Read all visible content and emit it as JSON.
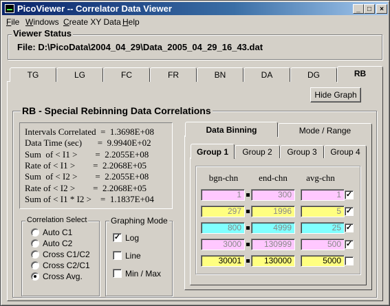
{
  "window": {
    "title": "PicoViewer -- Correlator Data Viewer",
    "min": "_",
    "max": "□",
    "close": "×"
  },
  "menu": [
    {
      "u": "F",
      "rest": "ile"
    },
    {
      "u": "W",
      "rest": "indows"
    },
    {
      "pre": "",
      "u": "C",
      "rest": "reate XY Data"
    },
    {
      "u": "H",
      "rest": "elp"
    }
  ],
  "viewer_status": {
    "title": "Viewer  Status",
    "file_line": "File: D:\\PicoData\\2004_04_29\\Data_2005_04_29_16_43.dat"
  },
  "tabs": [
    "TG",
    "LG",
    "FC",
    "FR",
    "BN",
    "DA",
    "DG",
    "RB"
  ],
  "hide_graph": "Hide Graph",
  "rb": {
    "title": "RB - Special Rebinning Data Correlations",
    "stats": [
      "Intervals Correlated  =  1.3698E+08",
      "Data Time (sec)       =  9.9940E+02",
      "Sum  of < I1 >        =  2.2055E+08",
      "Rate of < I1 >        =  2.2068E+05",
      "Sum  of < I2 >        =  2.2055E+08",
      "Rate of < I2 >        =  2.2068E+05",
      "Sum of < I1 * I2 >    =  1.1837E+04"
    ]
  },
  "correlation_select": {
    "title": "Correlation Select",
    "options": [
      "Auto  C1",
      "Auto  C2",
      "Cross C1/C2",
      "Cross C2/C1",
      "Cross Avg."
    ],
    "selected": 4
  },
  "graphing_mode": {
    "title": "Graphing  Mode",
    "options": [
      {
        "label": "Log",
        "checked": true
      },
      {
        "label": "Line",
        "checked": false
      },
      {
        "label": "Min / Max",
        "checked": false
      }
    ]
  },
  "binning_tabs": [
    "Data Binning",
    "Mode / Range"
  ],
  "group_tabs": [
    "Group 1",
    "Group 2",
    "Group 3",
    "Group 4"
  ],
  "columns": [
    "bgn-chn",
    "end-chn",
    "avg-chn"
  ],
  "rows": [
    {
      "bgn": "1",
      "end": "300",
      "avg": "1",
      "color": "#ffc8ff",
      "dim": true,
      "checked": true
    },
    {
      "bgn": "297",
      "end": "1996",
      "avg": "5",
      "color": "#ffff80",
      "dim": true,
      "checked": true
    },
    {
      "bgn": "800",
      "end": "4999",
      "avg": "25",
      "color": "#80ffff",
      "dim": true,
      "checked": true
    },
    {
      "bgn": "3000",
      "end": "130999",
      "avg": "500",
      "color": "#ffc8ff",
      "dim": true,
      "checked": true
    },
    {
      "bgn": "30001",
      "end": "130000",
      "avg": "5000",
      "color": "#ffff80",
      "dim": false,
      "checked": false
    }
  ]
}
